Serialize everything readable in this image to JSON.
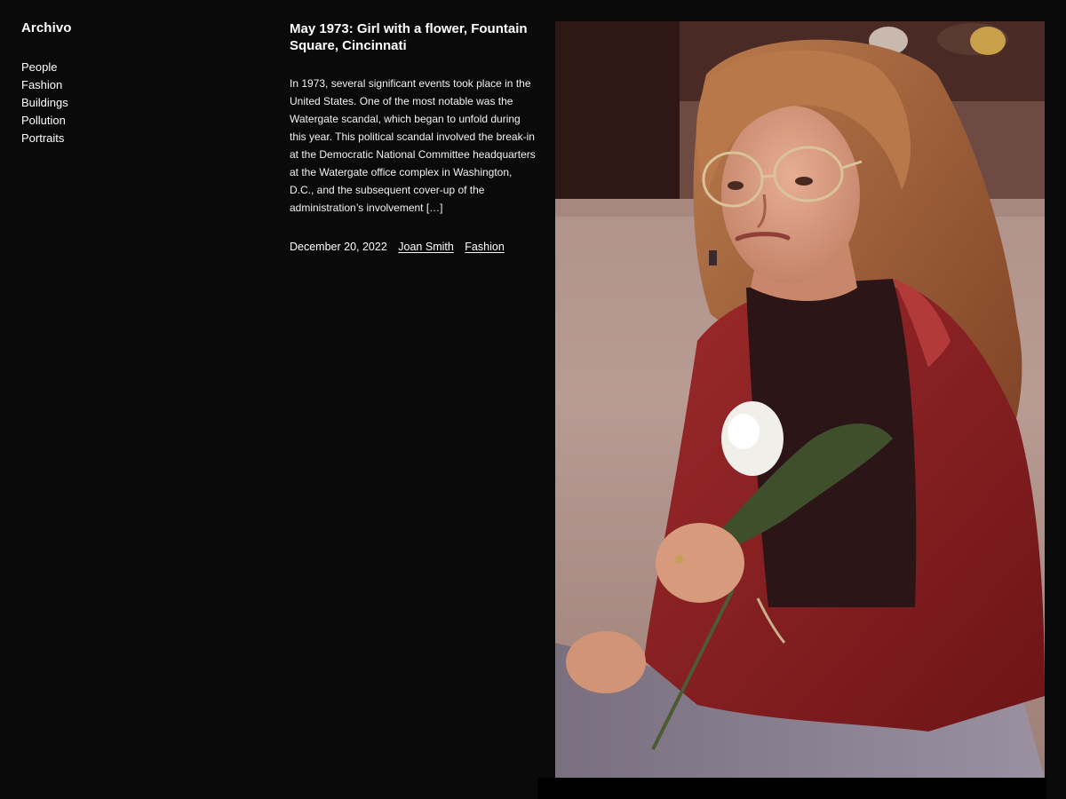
{
  "site": {
    "title": "Archivo"
  },
  "nav": {
    "items": [
      "People",
      "Fashion",
      "Buildings",
      "Pollution",
      "Portraits"
    ]
  },
  "post": {
    "title": "May 1973: Girl with a flower, Fountain Square, Cincinnati",
    "excerpt": "In 1973, several significant events took place in the United States. One of the most notable was the Watergate scandal, which began to unfold during this year. This political scandal involved the break-in at the Democratic National Committee headquarters at the Watergate office complex in Washington, D.C., and the subsequent cover-up of the administration’s involvement […]",
    "date": "December 20, 2022",
    "author": "Joan Smith",
    "category": "Fashion"
  },
  "colors": {
    "background": "#0a0a0a",
    "text": "#ffffff",
    "jacket": "#8e1f22",
    "hair": "#a8623a",
    "pavement": "#b99a92"
  }
}
